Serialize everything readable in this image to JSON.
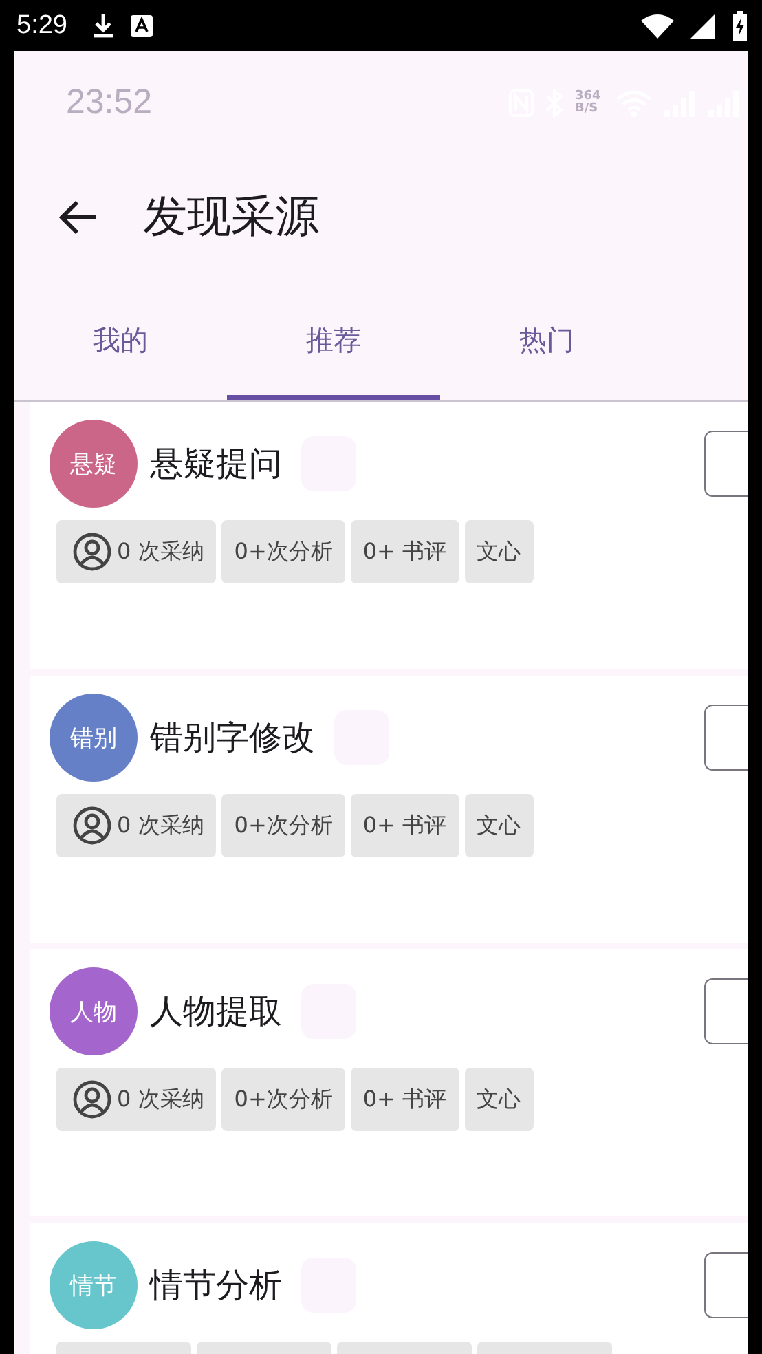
{
  "status_bar": {
    "time": "5:29"
  },
  "app_status": {
    "time": "23:52",
    "speed": "364 B/S"
  },
  "toolbar": {
    "title": "发现采源"
  },
  "tabs": [
    {
      "label": "我的",
      "selected": false
    },
    {
      "label": "推荐",
      "selected": true
    },
    {
      "label": "热门",
      "selected": false
    }
  ],
  "sources": [
    {
      "avatar": "悬疑",
      "color": "#cc6689",
      "name": "悬疑提问",
      "stats": [
        {
          "kind": "adopted",
          "label": "0 次采纳"
        },
        {
          "kind": "plain",
          "label": "0+次分析"
        },
        {
          "kind": "plain",
          "label": "0+ 书评"
        },
        {
          "kind": "plain",
          "label": "文心"
        }
      ]
    },
    {
      "avatar": "错别",
      "color": "#6680c8",
      "name": "错别字修改",
      "stats": [
        {
          "kind": "adopted",
          "label": "0 次采纳"
        },
        {
          "kind": "plain",
          "label": "0+次分析"
        },
        {
          "kind": "plain",
          "label": "0+ 书评"
        },
        {
          "kind": "plain",
          "label": "文心"
        }
      ]
    },
    {
      "avatar": "人物",
      "color": "#a466cc",
      "name": "人物提取",
      "stats": [
        {
          "kind": "adopted",
          "label": "0 次采纳"
        },
        {
          "kind": "plain",
          "label": "0+次分析"
        },
        {
          "kind": "plain",
          "label": "0+ 书评"
        },
        {
          "kind": "plain",
          "label": "文心"
        }
      ]
    },
    {
      "avatar": "情节",
      "color": "#66c6cc",
      "name": "情节分析",
      "stats": [
        {
          "kind": "plain"
        },
        {
          "kind": "plain"
        },
        {
          "kind": "plain"
        },
        {
          "kind": "plain"
        }
      ]
    }
  ]
}
